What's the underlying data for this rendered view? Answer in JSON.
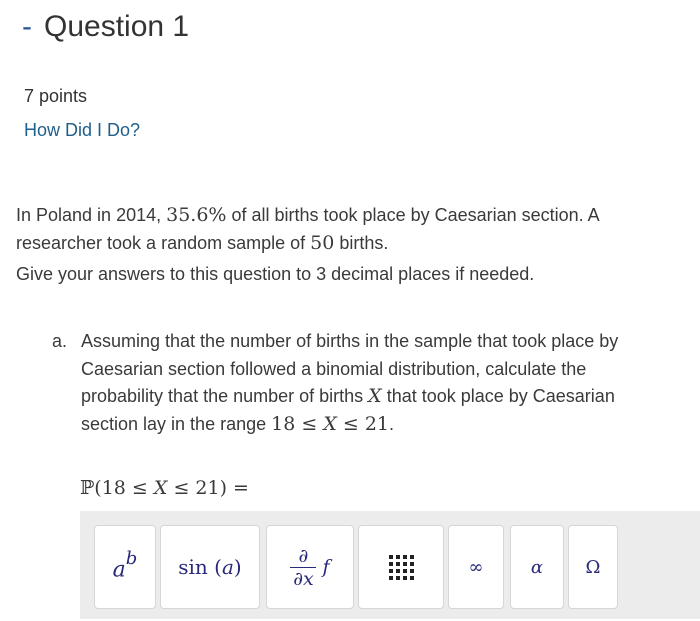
{
  "question": {
    "collapse_symbol": "-",
    "title": "Question 1",
    "points": "7 points",
    "how_link": "How Did I Do?"
  },
  "intro": {
    "p1_a": "In Poland in 2014, ",
    "p1_percent": "35.6%",
    "p1_b": " of all births took place by Caesarian section. A researcher took a random sample of ",
    "p1_n": "50",
    "p1_c": " births.",
    "p2": "Give your answers to this question to 3 decimal places if needed."
  },
  "part_a": {
    "marker": "a.",
    "text_1": "Assuming that the number of births in the sample that took place by Caesarian section followed a binomial distribution, calculate the probability that the number of births ",
    "var": "X",
    "text_2": " that took place by Caesarian section lay in the range ",
    "range_lo": "18 ≤ ",
    "range_var": "X",
    "range_hi": " ≤ 21",
    "text_3": "."
  },
  "answer": {
    "prob_symbol": "ℙ",
    "expr_a": "(18 ≤ ",
    "expr_var": "X",
    "expr_b": " ≤ 21) ="
  },
  "toolbar": {
    "power_base": "a",
    "power_exp": "b",
    "sin_fn": "sin",
    "sin_arg": "a",
    "deriv_top": "∂",
    "deriv_bottom": "∂x",
    "deriv_f": "f",
    "infinity": "∞",
    "alpha": "α",
    "omega": "Ω",
    "icons": [
      "power-icon",
      "sine-icon",
      "partial-derivative-icon",
      "matrix-icon",
      "infinity-icon",
      "alpha-icon",
      "omega-icon"
    ]
  }
}
